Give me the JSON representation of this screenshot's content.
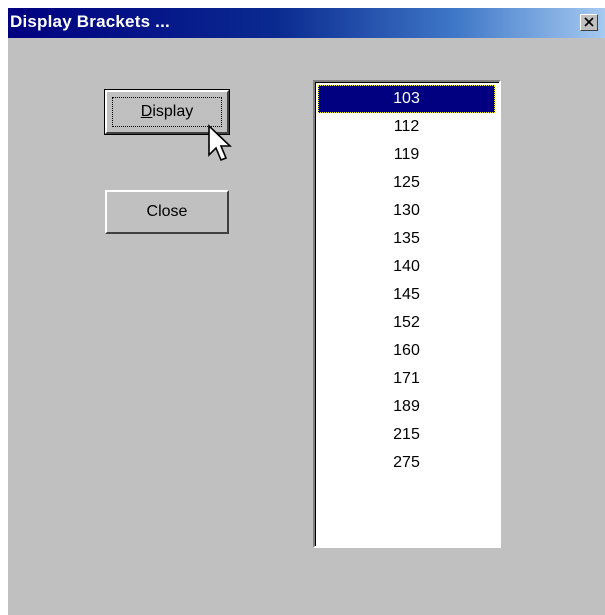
{
  "window": {
    "title": "Display Brackets ..."
  },
  "buttons": {
    "display_label": "Display",
    "display_mnemonic": "D",
    "display_rest": "isplay",
    "close_label": "Close"
  },
  "list": {
    "items": [
      "103",
      "112",
      "119",
      "125",
      "130",
      "135",
      "140",
      "145",
      "152",
      "160",
      "171",
      "189",
      "215",
      "275"
    ],
    "selected_value": "103"
  },
  "colors": {
    "face": "#c0c0c0",
    "title_start": "#000080",
    "title_end": "#a6caf0",
    "selection": "#000080"
  },
  "icons": {
    "close": "close-icon",
    "pointer": "arrow-cursor-icon"
  }
}
